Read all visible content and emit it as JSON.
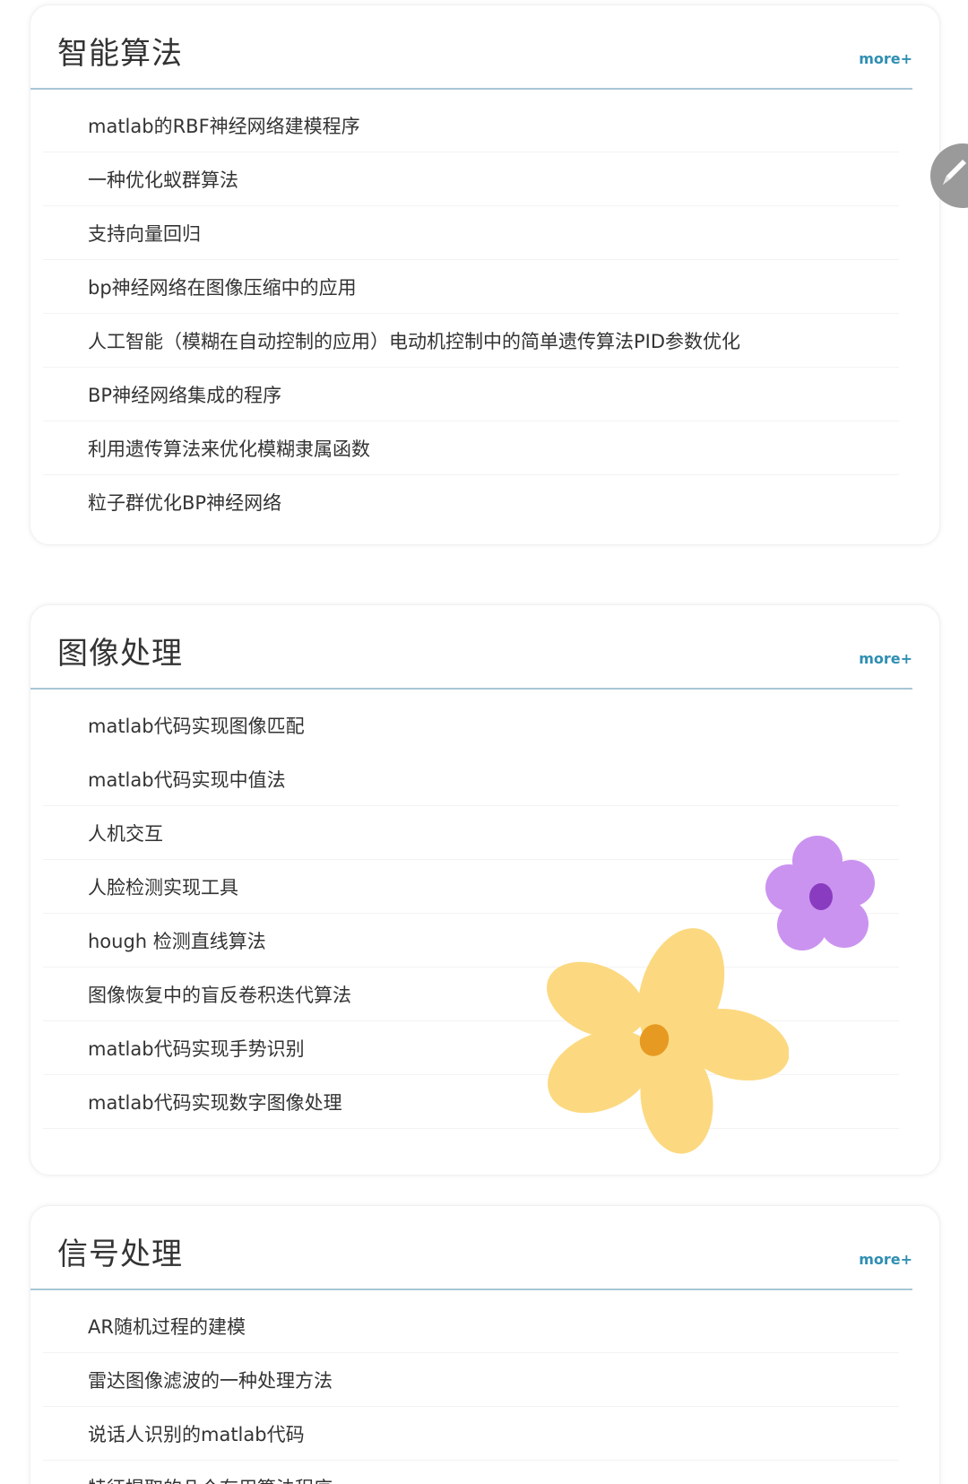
{
  "sections": [
    {
      "title": "智能算法",
      "more_label": "more+",
      "items": [
        "matlab的RBF神经网络建模程序",
        "一种优化蚁群算法",
        "支持向量回归",
        "bp神经网络在图像压缩中的应用",
        "人工智能（模糊在自动控制的应用）电动机控制中的简单遗传算法PID参数优化",
        "BP神经网络集成的程序",
        "利用遗传算法来优化模糊隶属函数",
        "粒子群优化BP神经网络"
      ]
    },
    {
      "title": "图像处理",
      "more_label": "more+",
      "items": [
        "matlab代码实现图像匹配",
        "matlab代码实现中值法",
        "人机交互",
        "人脸检测实现工具",
        "hough 检测直线算法",
        "图像恢复中的盲反卷积迭代算法",
        "matlab代码实现手势识别",
        "matlab代码实现数字图像处理"
      ]
    },
    {
      "title": "信号处理",
      "more_label": "more+",
      "items": [
        "AR随机过程的建模",
        "雷达图像滤波的一种处理方法",
        "说话人识别的matlab代码",
        "特征提取的几个有用算法程序"
      ]
    }
  ],
  "floating_button": {
    "icon": "pencil-icon"
  },
  "decorations": {
    "purple_flower_color": "#c98ef0",
    "yellow_flower_color": "#fcd77a"
  },
  "colors": {
    "more_link": "#2f8fb3",
    "header_divider": "#a9c6d6",
    "text": "#333333"
  }
}
